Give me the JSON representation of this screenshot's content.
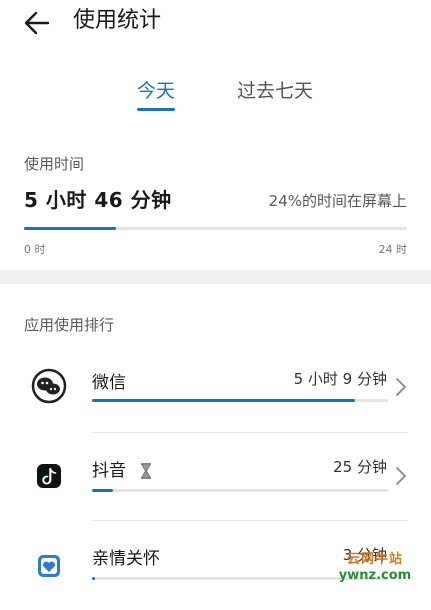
{
  "header": {
    "title": "使用统计"
  },
  "tabs": [
    {
      "label": "今天",
      "active": true
    },
    {
      "label": "过去七天",
      "active": false
    }
  ],
  "usage": {
    "section_label": "使用时间",
    "total_time": "5 小时 46 分钟",
    "percent_text": "24%的时间在屏幕上",
    "progress_fraction": 0.24,
    "axis_start": "0 时",
    "axis_end": "24 时"
  },
  "ranking": {
    "section_label": "应用使用排行",
    "apps": [
      {
        "name": "微信",
        "time": "5 小时 9 分钟",
        "icon": "wechat-icon",
        "bar_fraction": 0.89,
        "limit_icon": ""
      },
      {
        "name": "抖音",
        "time": "25 分钟",
        "icon": "douyin-icon",
        "bar_fraction": 0.07,
        "limit_icon": "hourglass-icon"
      },
      {
        "name": "亲情关怀",
        "time": "3 分钟",
        "icon": "family-care-icon",
        "bar_fraction": 0.01,
        "limit_icon": ""
      }
    ]
  },
  "watermark": {
    "line1": "云网牛站",
    "line2": "ywnz.com"
  },
  "colors": {
    "accent": "#1a73b9",
    "track": "#e4e4e4",
    "band": "#f1f1f1"
  }
}
